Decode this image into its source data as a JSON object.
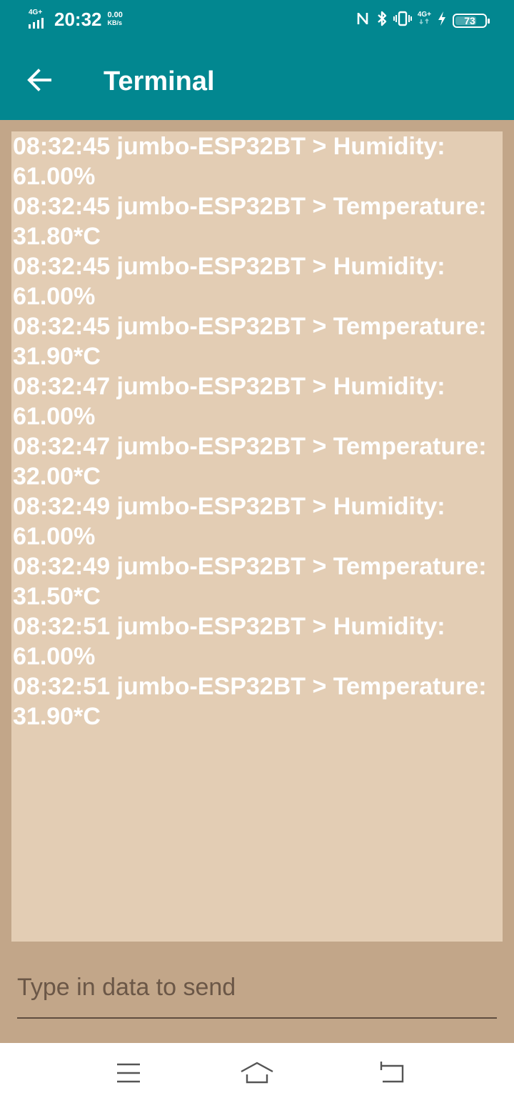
{
  "status_bar": {
    "network_label": "4G+",
    "time": "20:32",
    "speed_value": "0.00",
    "speed_unit": "KB/s",
    "right_network_label": "4G+",
    "battery_level": "73",
    "battery_fraction": 0.73
  },
  "app_bar": {
    "title": "Terminal",
    "back_icon": "arrow-left-icon"
  },
  "terminal": {
    "lines": [
      "08:32:45 jumbo-ESP32BT > Humidity: 61.00%",
      "08:32:45 jumbo-ESP32BT > Temperature: 31.80*C",
      "08:32:45 jumbo-ESP32BT > Humidity: 61.00%",
      "08:32:45 jumbo-ESP32BT > Temperature: 31.90*C",
      "08:32:47 jumbo-ESP32BT > Humidity: 61.00%",
      "08:32:47 jumbo-ESP32BT > Temperature: 32.00*C",
      "08:32:49 jumbo-ESP32BT > Humidity: 61.00%",
      "08:32:49 jumbo-ESP32BT > Temperature: 31.50*C",
      "08:32:51 jumbo-ESP32BT > Humidity: 61.00%",
      "08:32:51 jumbo-ESP32BT > Temperature: 31.90*C"
    ]
  },
  "input": {
    "value": "",
    "placeholder": "Type in data to send"
  },
  "nav_bar": {
    "icons": [
      "menu-icon",
      "home-icon",
      "back-icon"
    ]
  },
  "colors": {
    "header": "#028790",
    "background": "#c2a689",
    "terminal_bg": "#e3cdb4",
    "terminal_text": "#ffffff"
  }
}
